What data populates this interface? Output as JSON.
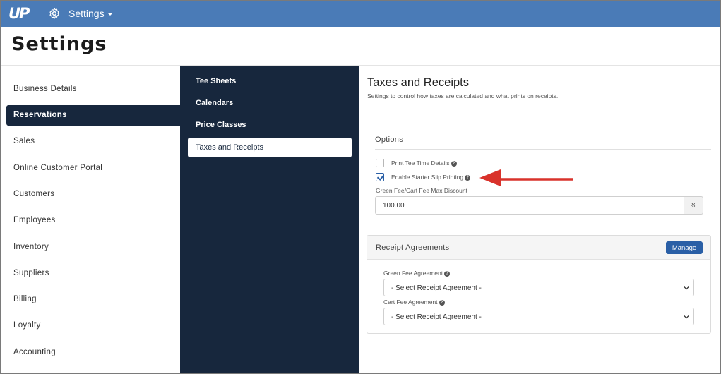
{
  "topbar": {
    "logo": "UP",
    "settings_icon": "gear-icon",
    "menu_label": "Settings"
  },
  "header": {
    "title": "Settings"
  },
  "left_nav": {
    "items": [
      {
        "label": "Business Details",
        "active": false
      },
      {
        "label": "Reservations",
        "active": true
      },
      {
        "label": "Sales",
        "active": false
      },
      {
        "label": "Online Customer Portal",
        "active": false
      },
      {
        "label": "Customers",
        "active": false
      },
      {
        "label": "Employees",
        "active": false
      },
      {
        "label": "Inventory",
        "active": false
      },
      {
        "label": "Suppliers",
        "active": false
      },
      {
        "label": "Billing",
        "active": false
      },
      {
        "label": "Loyalty",
        "active": false
      },
      {
        "label": "Accounting",
        "active": false
      }
    ]
  },
  "sub_nav": {
    "items": [
      {
        "label": "Tee Sheets",
        "active": false
      },
      {
        "label": "Calendars",
        "active": false
      },
      {
        "label": "Price Classes",
        "active": false
      },
      {
        "label": "Taxes and Receipts",
        "active": true
      }
    ]
  },
  "main": {
    "title": "Taxes and Receipts",
    "subtitle": "Settings to control how taxes are calculated and what prints on receipts.",
    "options": {
      "title": "Options",
      "checkboxes": [
        {
          "label": "Print Tee Time Details",
          "checked": false,
          "help_icon": "question-circle-icon"
        },
        {
          "label": "Enable Starter Slip Printing",
          "checked": true,
          "help_icon": "question-circle-icon"
        }
      ],
      "discount_label": "Green Fee/Cart Fee Max Discount",
      "discount_value": "100.00",
      "discount_unit": "%"
    },
    "receipt_agreements": {
      "title": "Receipt Agreements",
      "manage_label": "Manage",
      "green_fee_label": "Green Fee Agreement",
      "green_fee_value": "- Select Receipt Agreement -",
      "cart_fee_label": "Cart Fee Agreement",
      "cart_fee_value": "- Select Receipt Agreement -"
    }
  },
  "colors": {
    "topbar": "#4a7bb7",
    "nav_dark": "#17273d",
    "accent": "#2a5fa6",
    "arrow": "#d9322b"
  }
}
